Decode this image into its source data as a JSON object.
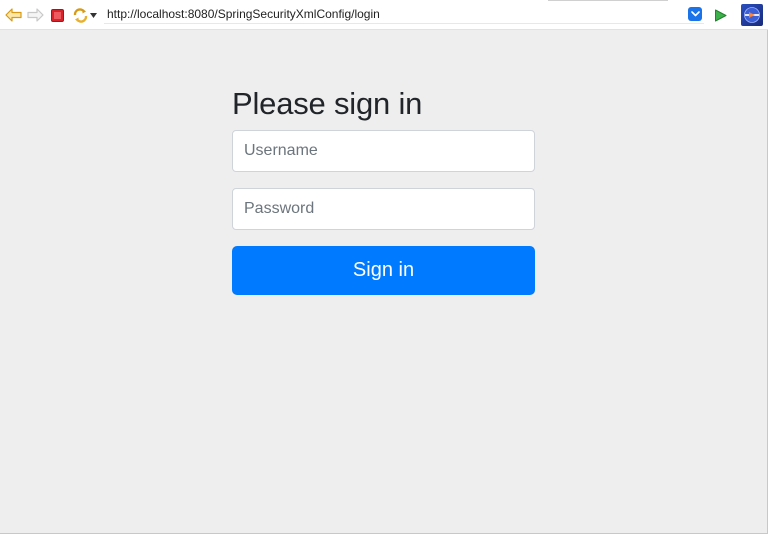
{
  "browser": {
    "url": "http://localhost:8080/SpringSecurityXmlConfig/login",
    "icons": {
      "back": "back-arrow-icon",
      "forward": "forward-arrow-icon",
      "stop": "stop-icon",
      "refresh": "refresh-icon",
      "refresh_menu": "chevron-down-icon",
      "url_dropdown": "chevron-down-icon",
      "go": "play-icon",
      "logo": "eclipse-logo-icon"
    },
    "colors": {
      "back_arrow": "#e0a020",
      "stop": "#d8232a",
      "refresh": "#e0a020",
      "go": "#2e9e3e",
      "url_dropdown": "#1a73e8"
    }
  },
  "login": {
    "heading": "Please sign in",
    "username_placeholder": "Username",
    "password_placeholder": "Password",
    "username_value": "",
    "password_value": "",
    "submit_label": "Sign in",
    "colors": {
      "button_bg": "#007bff",
      "heading": "#212529",
      "page_bg": "#eeeeee"
    }
  }
}
